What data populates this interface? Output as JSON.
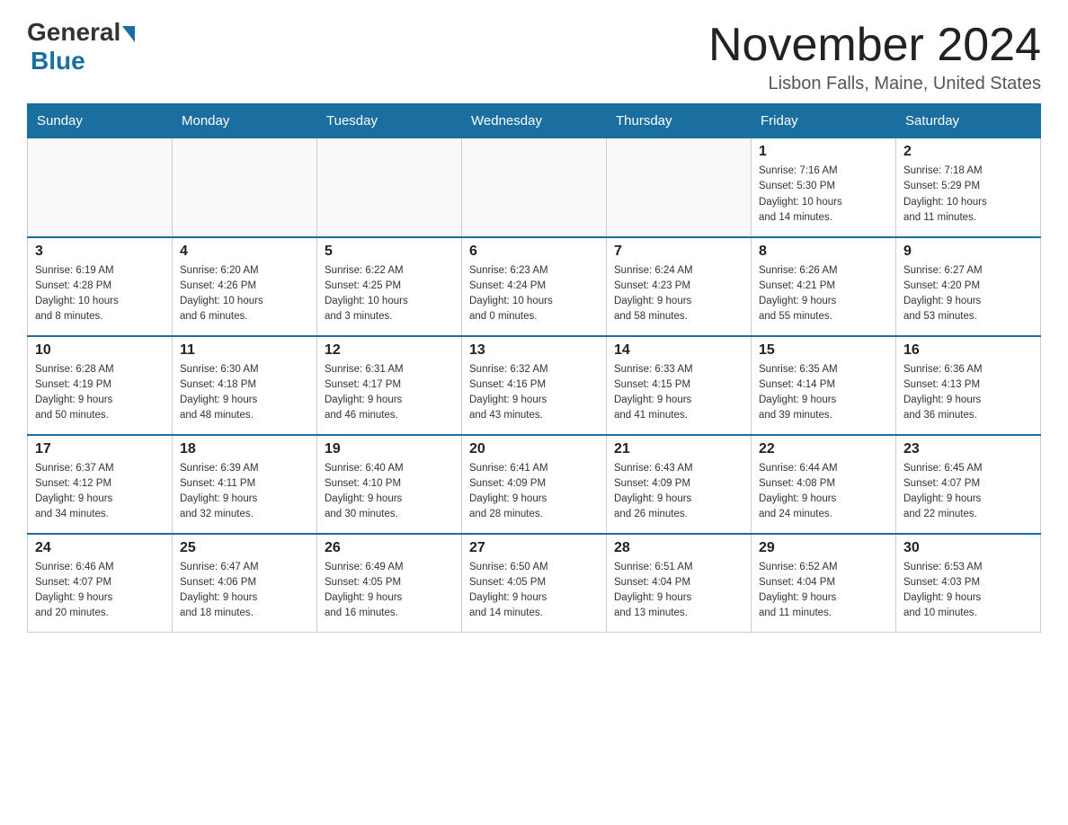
{
  "logo": {
    "general": "General",
    "blue": "Blue"
  },
  "header": {
    "title": "November 2024",
    "subtitle": "Lisbon Falls, Maine, United States"
  },
  "weekdays": [
    "Sunday",
    "Monday",
    "Tuesday",
    "Wednesday",
    "Thursday",
    "Friday",
    "Saturday"
  ],
  "weeks": [
    [
      {
        "day": "",
        "info": ""
      },
      {
        "day": "",
        "info": ""
      },
      {
        "day": "",
        "info": ""
      },
      {
        "day": "",
        "info": ""
      },
      {
        "day": "",
        "info": ""
      },
      {
        "day": "1",
        "info": "Sunrise: 7:16 AM\nSunset: 5:30 PM\nDaylight: 10 hours\nand 14 minutes."
      },
      {
        "day": "2",
        "info": "Sunrise: 7:18 AM\nSunset: 5:29 PM\nDaylight: 10 hours\nand 11 minutes."
      }
    ],
    [
      {
        "day": "3",
        "info": "Sunrise: 6:19 AM\nSunset: 4:28 PM\nDaylight: 10 hours\nand 8 minutes."
      },
      {
        "day": "4",
        "info": "Sunrise: 6:20 AM\nSunset: 4:26 PM\nDaylight: 10 hours\nand 6 minutes."
      },
      {
        "day": "5",
        "info": "Sunrise: 6:22 AM\nSunset: 4:25 PM\nDaylight: 10 hours\nand 3 minutes."
      },
      {
        "day": "6",
        "info": "Sunrise: 6:23 AM\nSunset: 4:24 PM\nDaylight: 10 hours\nand 0 minutes."
      },
      {
        "day": "7",
        "info": "Sunrise: 6:24 AM\nSunset: 4:23 PM\nDaylight: 9 hours\nand 58 minutes."
      },
      {
        "day": "8",
        "info": "Sunrise: 6:26 AM\nSunset: 4:21 PM\nDaylight: 9 hours\nand 55 minutes."
      },
      {
        "day": "9",
        "info": "Sunrise: 6:27 AM\nSunset: 4:20 PM\nDaylight: 9 hours\nand 53 minutes."
      }
    ],
    [
      {
        "day": "10",
        "info": "Sunrise: 6:28 AM\nSunset: 4:19 PM\nDaylight: 9 hours\nand 50 minutes."
      },
      {
        "day": "11",
        "info": "Sunrise: 6:30 AM\nSunset: 4:18 PM\nDaylight: 9 hours\nand 48 minutes."
      },
      {
        "day": "12",
        "info": "Sunrise: 6:31 AM\nSunset: 4:17 PM\nDaylight: 9 hours\nand 46 minutes."
      },
      {
        "day": "13",
        "info": "Sunrise: 6:32 AM\nSunset: 4:16 PM\nDaylight: 9 hours\nand 43 minutes."
      },
      {
        "day": "14",
        "info": "Sunrise: 6:33 AM\nSunset: 4:15 PM\nDaylight: 9 hours\nand 41 minutes."
      },
      {
        "day": "15",
        "info": "Sunrise: 6:35 AM\nSunset: 4:14 PM\nDaylight: 9 hours\nand 39 minutes."
      },
      {
        "day": "16",
        "info": "Sunrise: 6:36 AM\nSunset: 4:13 PM\nDaylight: 9 hours\nand 36 minutes."
      }
    ],
    [
      {
        "day": "17",
        "info": "Sunrise: 6:37 AM\nSunset: 4:12 PM\nDaylight: 9 hours\nand 34 minutes."
      },
      {
        "day": "18",
        "info": "Sunrise: 6:39 AM\nSunset: 4:11 PM\nDaylight: 9 hours\nand 32 minutes."
      },
      {
        "day": "19",
        "info": "Sunrise: 6:40 AM\nSunset: 4:10 PM\nDaylight: 9 hours\nand 30 minutes."
      },
      {
        "day": "20",
        "info": "Sunrise: 6:41 AM\nSunset: 4:09 PM\nDaylight: 9 hours\nand 28 minutes."
      },
      {
        "day": "21",
        "info": "Sunrise: 6:43 AM\nSunset: 4:09 PM\nDaylight: 9 hours\nand 26 minutes."
      },
      {
        "day": "22",
        "info": "Sunrise: 6:44 AM\nSunset: 4:08 PM\nDaylight: 9 hours\nand 24 minutes."
      },
      {
        "day": "23",
        "info": "Sunrise: 6:45 AM\nSunset: 4:07 PM\nDaylight: 9 hours\nand 22 minutes."
      }
    ],
    [
      {
        "day": "24",
        "info": "Sunrise: 6:46 AM\nSunset: 4:07 PM\nDaylight: 9 hours\nand 20 minutes."
      },
      {
        "day": "25",
        "info": "Sunrise: 6:47 AM\nSunset: 4:06 PM\nDaylight: 9 hours\nand 18 minutes."
      },
      {
        "day": "26",
        "info": "Sunrise: 6:49 AM\nSunset: 4:05 PM\nDaylight: 9 hours\nand 16 minutes."
      },
      {
        "day": "27",
        "info": "Sunrise: 6:50 AM\nSunset: 4:05 PM\nDaylight: 9 hours\nand 14 minutes."
      },
      {
        "day": "28",
        "info": "Sunrise: 6:51 AM\nSunset: 4:04 PM\nDaylight: 9 hours\nand 13 minutes."
      },
      {
        "day": "29",
        "info": "Sunrise: 6:52 AM\nSunset: 4:04 PM\nDaylight: 9 hours\nand 11 minutes."
      },
      {
        "day": "30",
        "info": "Sunrise: 6:53 AM\nSunset: 4:03 PM\nDaylight: 9 hours\nand 10 minutes."
      }
    ]
  ]
}
